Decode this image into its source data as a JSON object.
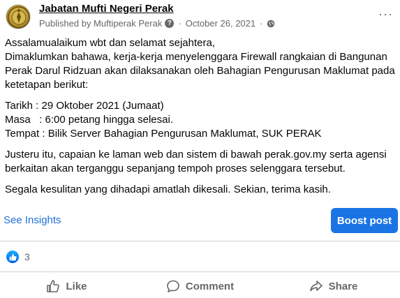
{
  "post": {
    "page_name": "Jabatan Mufti Negeri Perak",
    "published_by": "Published by Muftiperak Perak",
    "date": "October 26, 2021",
    "dot": "·",
    "lines": [
      "Assalamualaikum wbt dan selamat sejahtera,",
      "Dimaklumkan bahawa, kerja-kerja menyelenggara Firewall rangkaian di Bangunan",
      "Perak Darul Ridzuan akan dilaksanakan oleh Bahagian Pengurusan Maklumat pada",
      "ketetapan berikut:",
      "Tarikh : 29 Oktober 2021 (Jumaat)",
      "Masa   : 6:00 petang hingga selesai.",
      "Tempat : Bilik Server Bahagian Pengurusan Maklumat, SUK PERAK",
      "Justeru itu, capaian ke laman web dan sistem di bawah perak.gov.my serta agensi",
      "berkaitan akan terganggu sepanjang tempoh proses selenggara tersebut.",
      "Segala kesulitan yang dihadapi amatlah dikesali. Sekian, terima kasih."
    ]
  },
  "insights": {
    "see_insights_label": "See Insights",
    "boost_label": "Boost post"
  },
  "reactions": {
    "count": "3"
  },
  "actions": {
    "like_label": "Like",
    "comment_label": "Comment",
    "share_label": "Share"
  },
  "colors": {
    "accent": "#1b74e4",
    "link": "#216fdb",
    "muted": "#65676b"
  }
}
